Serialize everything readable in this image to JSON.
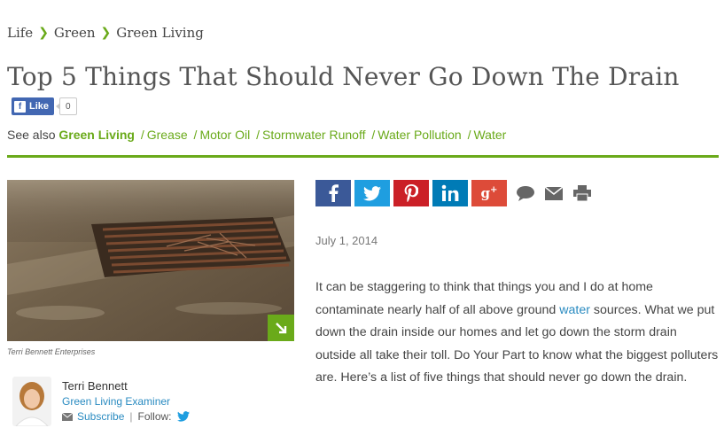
{
  "breadcrumb": {
    "items": [
      "Life",
      "Green",
      "Green Living"
    ]
  },
  "article": {
    "title": "Top 5 Things That Should Never Go Down The Drain",
    "date": "July 1, 2014",
    "body_part1": "It can be staggering to think that things you and I do at home contaminate nearly half of all above ground ",
    "body_link": "water",
    "body_part2": " sources. What we put down the drain inside our homes and let go down the storm drain outside all take their toll. Do Your Part to know what the biggest polluters are. Here’s a list of five things that should never go down the drain."
  },
  "facebook_like": {
    "label": "Like",
    "count": "0"
  },
  "see_also": {
    "label": "See also",
    "primary": "Green Living",
    "links": [
      "Grease",
      "Motor Oil",
      "Stormwater Runoff",
      "Water Pollution",
      "Water"
    ]
  },
  "photo": {
    "credit": "Terri Bennett Enterprises"
  },
  "author": {
    "name": "Terri Bennett",
    "role": "Green Living Examiner",
    "subscribe_label": "Subscribe",
    "follow_label": "Follow:"
  },
  "share_icons": [
    "facebook-icon",
    "twitter-icon",
    "pinterest-icon",
    "linkedin-icon",
    "google-plus-icon",
    "comment-icon",
    "email-icon",
    "print-icon"
  ],
  "colors": {
    "accent_green": "#6aaa1a",
    "link_blue": "#2a8bc1",
    "facebook": "#3b5998",
    "twitter": "#1f9ee0",
    "pinterest": "#cb2027",
    "linkedin": "#007bb6",
    "google_plus": "#dd4b39"
  }
}
